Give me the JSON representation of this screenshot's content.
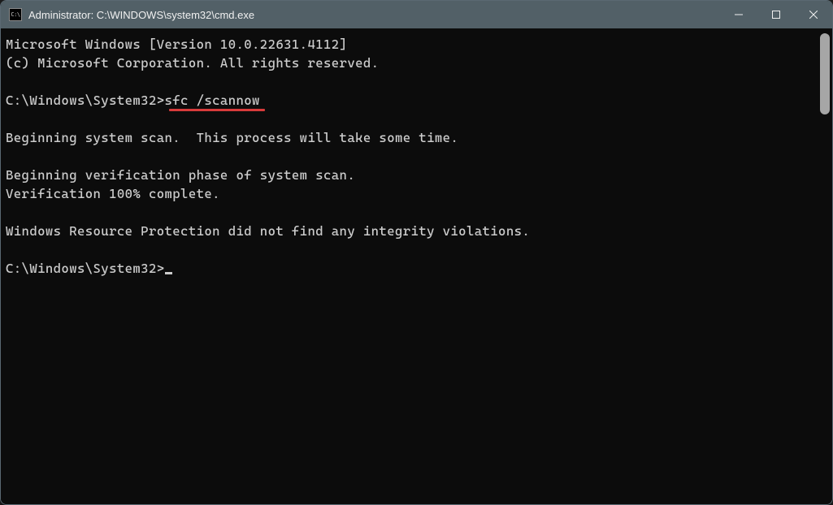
{
  "titlebar": {
    "icon_label": "C:\\",
    "title": "Administrator: C:\\WINDOWS\\system32\\cmd.exe"
  },
  "window_controls": {
    "minimize": "Minimize",
    "maximize": "Maximize",
    "close": "Close"
  },
  "terminal": {
    "line1": "Microsoft Windows [Version 10.0.22631.4112]",
    "line2": "(c) Microsoft Corporation. All rights reserved.",
    "blank1": "",
    "prompt1_path": "C:\\Windows\\System32>",
    "prompt1_cmd": "sfc /scannow",
    "blank2": "",
    "line3": "Beginning system scan.  This process will take some time.",
    "blank3": "",
    "line4": "Beginning verification phase of system scan.",
    "line5": "Verification 100% complete.",
    "blank4": "",
    "line6": "Windows Resource Protection did not find any integrity violations.",
    "blank5": "",
    "prompt2_path": "C:\\Windows\\System32>"
  },
  "annotation": {
    "underline_color": "#d83b3b"
  }
}
